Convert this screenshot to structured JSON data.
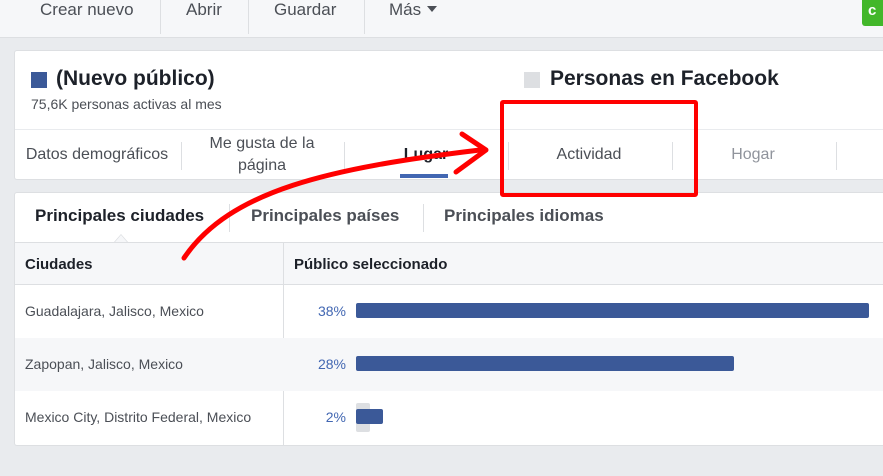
{
  "toolbar": {
    "create_label": "Crear nuevo",
    "open_label": "Abrir",
    "save_label": "Guardar",
    "more_label": "Más",
    "action_label": "c"
  },
  "audience": {
    "title": "(Nuevo público)",
    "subtitle": "75,6K personas activas al mes",
    "compare_title": "Personas en Facebook",
    "title_color": "#3b5998",
    "compare_color": "#dddfe2"
  },
  "tabs": [
    {
      "label": "Datos demográficos"
    },
    {
      "label": "Me gusta de la página"
    },
    {
      "label": "Lugar"
    },
    {
      "label": "Actividad"
    },
    {
      "label": "Hogar"
    }
  ],
  "subtabs": [
    {
      "label": "Principales ciudades"
    },
    {
      "label": "Principales países"
    },
    {
      "label": "Principales idiomas"
    }
  ],
  "table": {
    "columns": [
      "Ciudades",
      "Público seleccionado"
    ],
    "rows": [
      {
        "city": "Guadalajara, Jalisco, Mexico",
        "pct": "38%",
        "value": 38
      },
      {
        "city": "Zapopan, Jalisco, Mexico",
        "pct": "28%",
        "value": 28
      },
      {
        "city": "Mexico City, Distrito Federal, Mexico",
        "pct": "2%",
        "value": 2
      }
    ]
  },
  "colors": {
    "accent": "#4267b2",
    "bar": "#3b5998",
    "annotation": "#ff0000",
    "green_button": "#42b72a"
  }
}
